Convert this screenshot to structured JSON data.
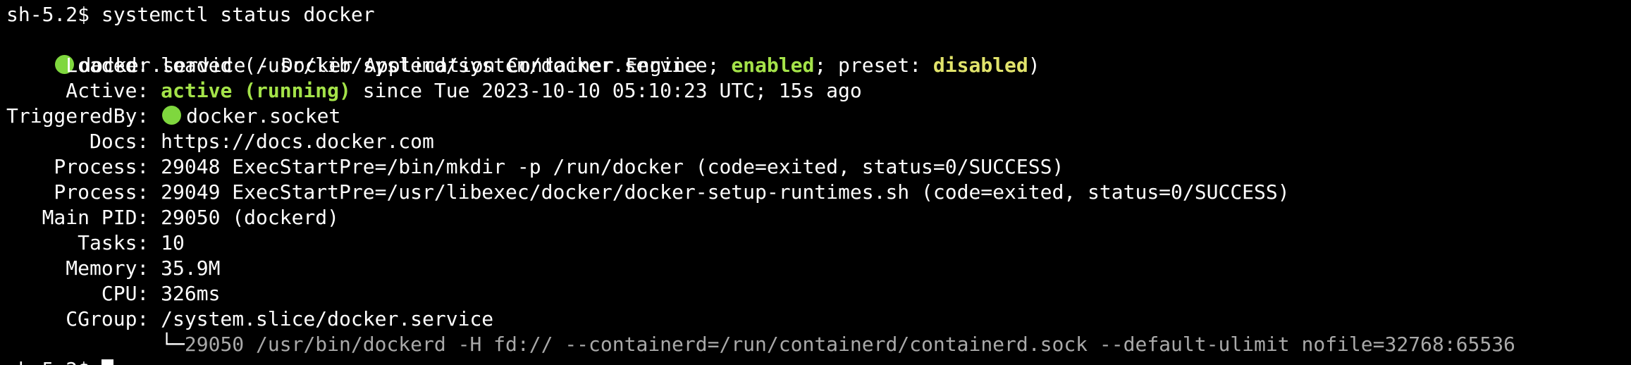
{
  "terminal": {
    "command_line": "sh-5.2$ systemctl status docker",
    "service_line": "docker.service - Docker Application Container Engine",
    "loaded": {
      "label": "     Loaded: ",
      "prefix": "loaded (/usr/lib/systemd/system/docker.service; ",
      "enabled": "enabled",
      "middle": "; preset: ",
      "disabled": "disabled",
      "suffix": ")"
    },
    "active": {
      "label": "     Active: ",
      "state": "active (running)",
      "rest": " since Tue 2023-10-10 05:10:23 UTC; 15s ago"
    },
    "triggered_by": {
      "label": "TriggeredBy: ",
      "value": "docker.socket"
    },
    "docs": "       Docs: https://docs.docker.com",
    "process_1": "    Process: 29048 ExecStartPre=/bin/mkdir -p /run/docker (code=exited, status=0/SUCCESS)",
    "process_2": "    Process: 29049 ExecStartPre=/usr/libexec/docker/docker-setup-runtimes.sh (code=exited, status=0/SUCCESS)",
    "main_pid": "   Main PID: 29050 (dockerd)",
    "tasks": "      Tasks: 10",
    "memory": "     Memory: 35.9M",
    "cpu": "        CPU: 326ms",
    "cgroup": "     CGroup: /system.slice/docker.service",
    "cgroup_tree_prefix": "             └─",
    "cgroup_tree_value": "29050 /usr/bin/dockerd -H fd:// --containerd=/run/containerd/containerd.sock --default-ulimit nofile=32768:65536",
    "prompt": "sh-5.2$ ",
    "status_color": "#7fd73e"
  }
}
